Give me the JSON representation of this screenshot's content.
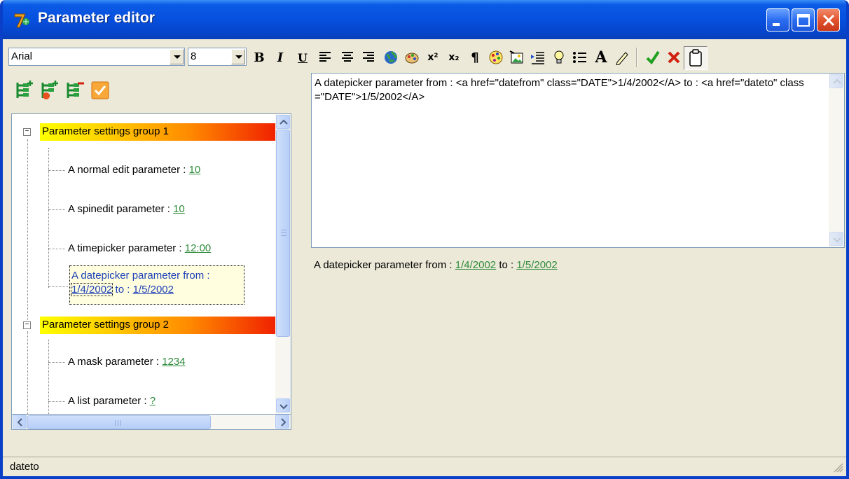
{
  "window": {
    "title": "Parameter editor"
  },
  "toolbar": {
    "font_name": "Arial",
    "font_size": "8",
    "bold_label": "B",
    "italic_label": "I",
    "underline_label": "U",
    "superscript_label": "x²",
    "subscript_label": "x₂",
    "paragraph_label": "¶",
    "font_label": "A"
  },
  "tree": {
    "groups": [
      {
        "label": "Parameter settings group 1",
        "items": [
          {
            "label": "A normal edit parameter : ",
            "value": "10"
          },
          {
            "label": "A spinedit parameter : ",
            "value": "10"
          },
          {
            "label": "A timepicker parameter : ",
            "value": "12:00"
          },
          {
            "label_line1": "A datepicker parameter from :",
            "value_from": "1/4/2002",
            "mid": " to : ",
            "value_to": "1/5/2002"
          }
        ]
      },
      {
        "label": "Parameter settings group 2",
        "items": [
          {
            "label": "A mask parameter : ",
            "value": "1234"
          },
          {
            "label": "A list parameter : ",
            "value": "?"
          }
        ]
      }
    ]
  },
  "editor": {
    "source_text": "A datepicker parameter from : <a href=\"datefrom\" class=\"DATE\">1/4/2002</A> to : <a href=\"dateto\" class=\"DATE\">1/5/2002</A>"
  },
  "preview": {
    "prefix": "A datepicker parameter from : ",
    "from_value": "1/4/2002",
    "middle": " to : ",
    "to_value": "1/5/2002"
  },
  "status": {
    "text": "dateto"
  },
  "colors": {
    "titlebar": "#0650de",
    "link_green": "#2e8b3a",
    "link_blue": "#1d3fb6",
    "group_gradient_start": "#ffff00",
    "group_gradient_end": "#ee1100"
  }
}
